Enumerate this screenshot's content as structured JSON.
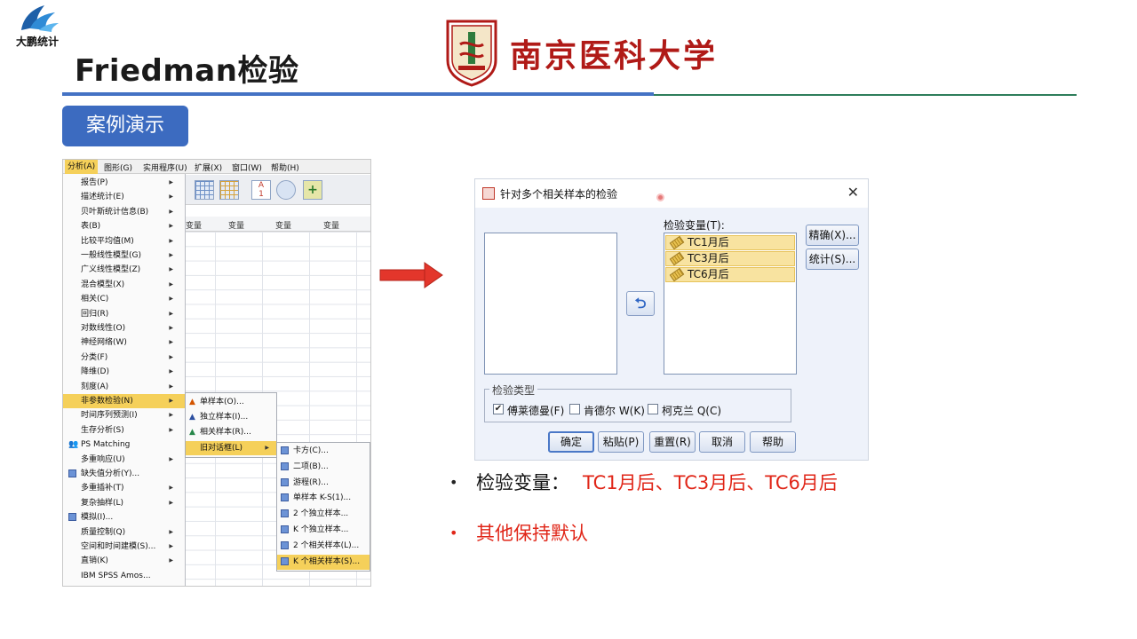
{
  "header": {
    "brand_text": "大鹏统计",
    "title": "Friedman检验",
    "university": "南京医科大学"
  },
  "case_button": "案例演示",
  "spss": {
    "menubar": [
      "分析(A)",
      "图形(G)",
      "实用程序(U)",
      "扩展(X)",
      "窗口(W)",
      "帮助(H)"
    ],
    "grid_headers": [
      "变量",
      "变量",
      "变量",
      "变量"
    ],
    "main_menu": [
      {
        "label": "报告(P)",
        "arrow": true
      },
      {
        "label": "描述统计(E)",
        "arrow": true
      },
      {
        "label": "贝叶斯统计信息(B)",
        "arrow": true
      },
      {
        "label": "表(B)",
        "arrow": true
      },
      {
        "label": "比较平均值(M)",
        "arrow": true
      },
      {
        "label": "一般线性模型(G)",
        "arrow": true
      },
      {
        "label": "广义线性模型(Z)",
        "arrow": true
      },
      {
        "label": "混合模型(X)",
        "arrow": true
      },
      {
        "label": "相关(C)",
        "arrow": true
      },
      {
        "label": "回归(R)",
        "arrow": true
      },
      {
        "label": "对数线性(O)",
        "arrow": true
      },
      {
        "label": "神经网络(W)",
        "arrow": true
      },
      {
        "label": "分类(F)",
        "arrow": true
      },
      {
        "label": "降维(D)",
        "arrow": true
      },
      {
        "label": "刻度(A)",
        "arrow": true
      },
      {
        "label": "非参数检验(N)",
        "arrow": true,
        "highlight": true
      },
      {
        "label": "时间序列预测(I)",
        "arrow": true
      },
      {
        "label": "生存分析(S)",
        "arrow": true
      },
      {
        "label": "PS Matching",
        "arrow": false,
        "icon": "people-icon"
      },
      {
        "label": "多重响应(U)",
        "arrow": true
      },
      {
        "label": "缺失值分析(Y)...",
        "arrow": false,
        "icon": "missing-icon"
      },
      {
        "label": "多重插补(T)",
        "arrow": true
      },
      {
        "label": "复杂抽样(L)",
        "arrow": true
      },
      {
        "label": "模拟(I)...",
        "arrow": false,
        "icon": "simulate-icon"
      },
      {
        "label": "质量控制(Q)",
        "arrow": true
      },
      {
        "label": "空间和时间建模(S)...",
        "arrow": true
      },
      {
        "label": "直销(K)",
        "arrow": true
      },
      {
        "label": "IBM SPSS Amos...",
        "arrow": false
      }
    ],
    "submenu1": [
      {
        "label": "单样本(O)..."
      },
      {
        "label": "独立样本(I)..."
      },
      {
        "label": "相关样本(R)..."
      },
      {
        "label": "旧对话框(L)",
        "highlight": true
      }
    ],
    "submenu2": [
      {
        "label": "卡方(C)..."
      },
      {
        "label": "二项(B)..."
      },
      {
        "label": "游程(R)..."
      },
      {
        "label": "单样本 K-S(1)..."
      },
      {
        "label": "2 个独立样本..."
      },
      {
        "label": "K 个独立样本..."
      },
      {
        "label": "2 个相关样本(L)..."
      },
      {
        "label": "K 个相关样本(S)...",
        "highlight": true
      }
    ]
  },
  "dialog": {
    "title": "针对多个相关样本的检验",
    "test_vars_label": "检验变量(T):",
    "test_vars": [
      "TC1月后",
      "TC3月后",
      "TC6月后"
    ],
    "side_buttons": [
      "精确(X)...",
      "统计(S)..."
    ],
    "test_type_label": "检验类型",
    "checkboxes": [
      {
        "label": "傅莱德曼(F)",
        "checked": true
      },
      {
        "label": "肯德尔 W(K)",
        "checked": false
      },
      {
        "label": "柯克兰 Q(C)",
        "checked": false
      }
    ],
    "buttons": [
      "确定",
      "粘贴(P)",
      "重置(R)",
      "取消",
      "帮助"
    ]
  },
  "bullets": {
    "b1_key": "检验变量：",
    "b1_value": "TC1月后、TC3月后、TC6月后",
    "b2_value": "其他保持默认"
  },
  "colors": {
    "accent_blue": "#4472c4",
    "accent_red": "#e02618",
    "university_red": "#b01a17",
    "menu_highlight": "#f5d05a"
  }
}
